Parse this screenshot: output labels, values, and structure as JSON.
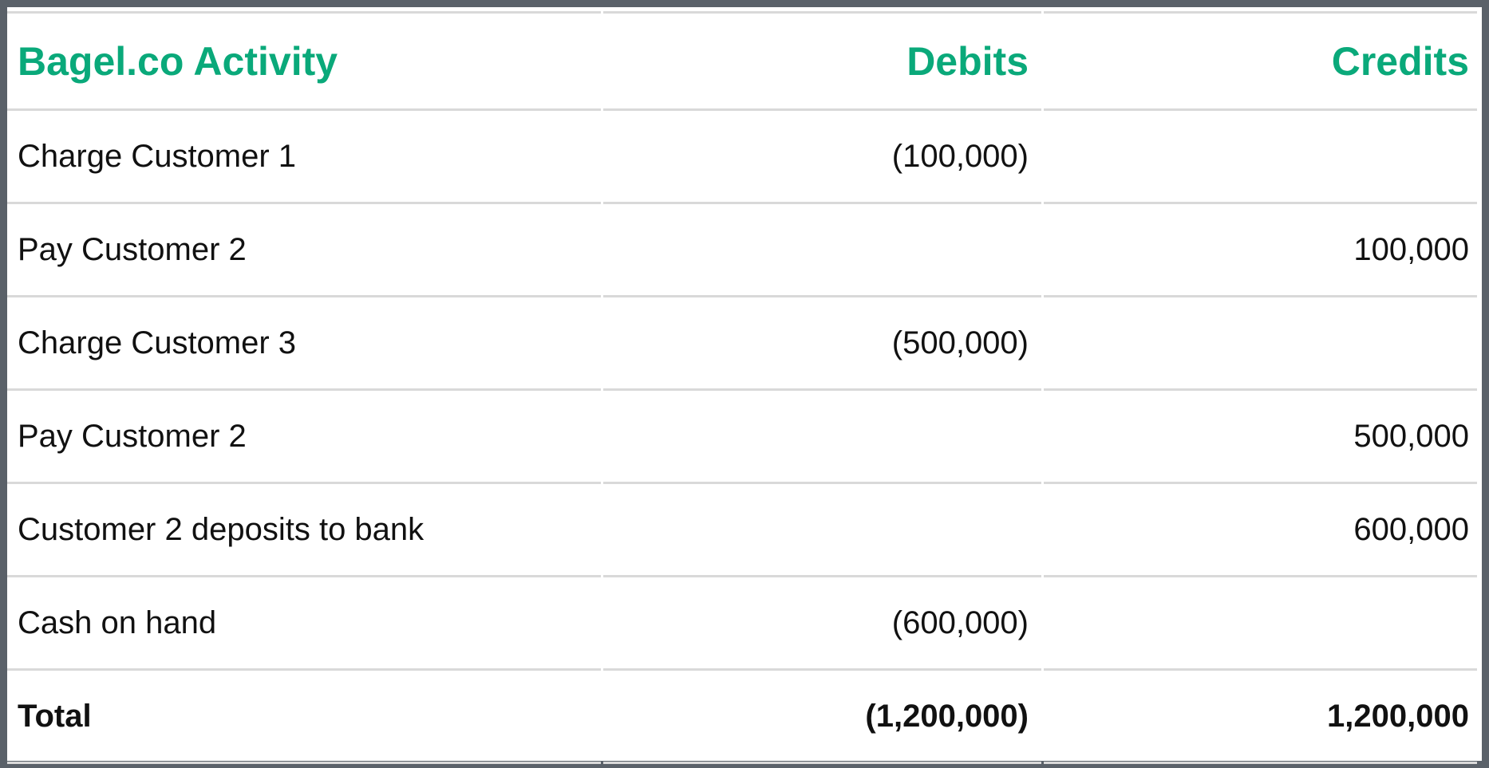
{
  "table": {
    "headers": [
      "Bagel.co Activity",
      "Debits",
      "Credits"
    ],
    "rows": [
      {
        "activity": "Charge Customer 1",
        "debit": "(100,000)",
        "credit": ""
      },
      {
        "activity": "Pay Customer 2",
        "debit": "",
        "credit": "100,000"
      },
      {
        "activity": "Charge Customer 3",
        "debit": "(500,000)",
        "credit": ""
      },
      {
        "activity": "Pay Customer 2",
        "debit": "",
        "credit": "500,000"
      },
      {
        "activity": "Customer 2 deposits to bank",
        "debit": "",
        "credit": "600,000"
      },
      {
        "activity": "Cash on hand",
        "debit": "(600,000)",
        "credit": ""
      }
    ],
    "total": {
      "activity": "Total",
      "debit": "(1,200,000)",
      "credit": "1,200,000"
    }
  },
  "colors": {
    "header_accent": "#0aa97a",
    "frame": "#5a6169",
    "rule": "#d9d9d9"
  }
}
